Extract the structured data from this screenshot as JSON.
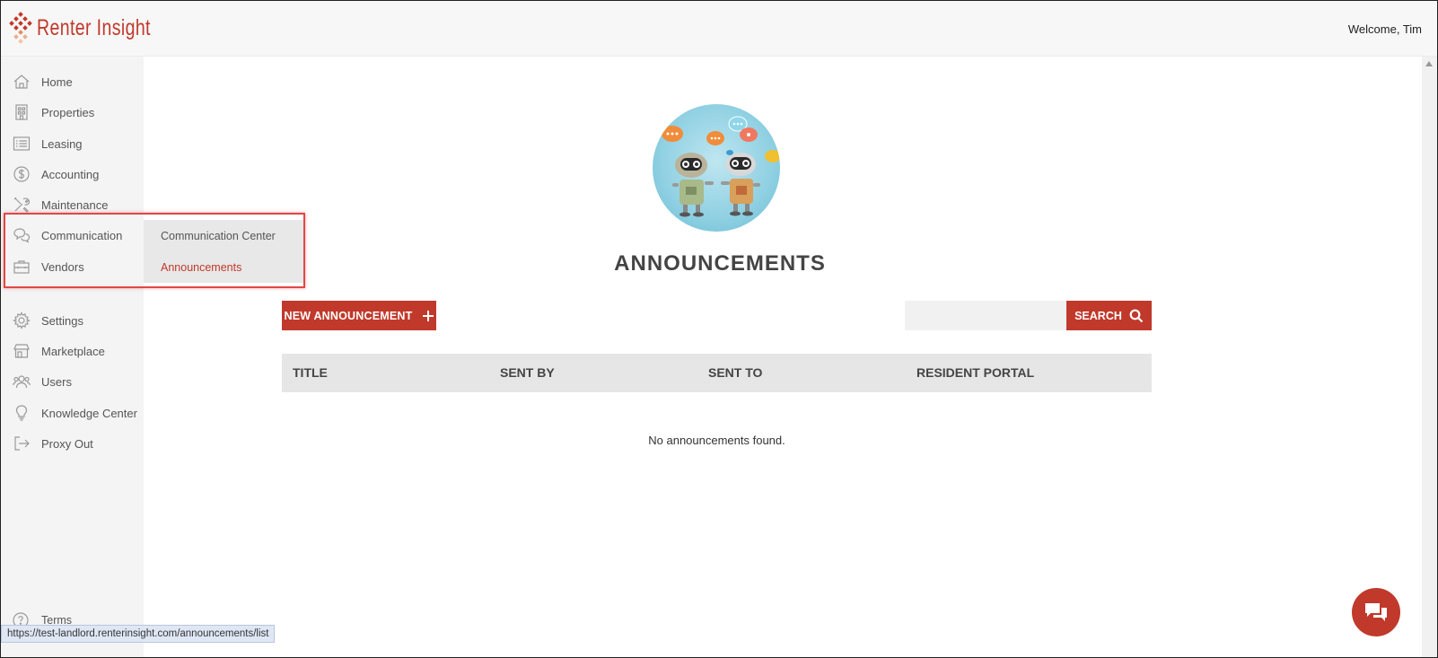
{
  "header": {
    "logo_text": "Renter Insight",
    "welcome_text": "Welcome, Tim"
  },
  "sidebar": {
    "items": [
      {
        "label": "Home",
        "icon": "home-icon"
      },
      {
        "label": "Properties",
        "icon": "building-icon"
      },
      {
        "label": "Leasing",
        "icon": "list-icon"
      },
      {
        "label": "Accounting",
        "icon": "dollar-icon"
      },
      {
        "label": "Maintenance",
        "icon": "tools-icon"
      },
      {
        "label": "Communication",
        "icon": "chat-icon"
      },
      {
        "label": "Vendors",
        "icon": "toolbox-icon"
      },
      {
        "label": "Settings",
        "icon": "gear-icon"
      },
      {
        "label": "Marketplace",
        "icon": "store-icon"
      },
      {
        "label": "Users",
        "icon": "users-icon"
      },
      {
        "label": "Knowledge Center",
        "icon": "lightbulb-icon"
      },
      {
        "label": "Proxy Out",
        "icon": "exit-icon"
      }
    ],
    "terms_label": "Terms"
  },
  "submenu": {
    "items": [
      {
        "label": "Communication Center",
        "active": false
      },
      {
        "label": "Announcements",
        "active": true
      }
    ]
  },
  "main": {
    "title": "ANNOUNCEMENTS",
    "new_button_label": "NEW ANNOUNCEMENT",
    "new_button_icon": "plus-icon",
    "search": {
      "value": "",
      "placeholder": "",
      "button_label": "SEARCH",
      "icon": "search-icon"
    },
    "table": {
      "columns": [
        "TITLE",
        "SENT BY",
        "SENT TO",
        "RESIDENT PORTAL"
      ],
      "empty_message": "No announcements found."
    }
  },
  "status_url": "https://test-landlord.renterinsight.com/announcements/list",
  "colors": {
    "accent": "#c0392b",
    "highlight": "#e04848",
    "sidebar_bg": "#f4f4f4"
  }
}
